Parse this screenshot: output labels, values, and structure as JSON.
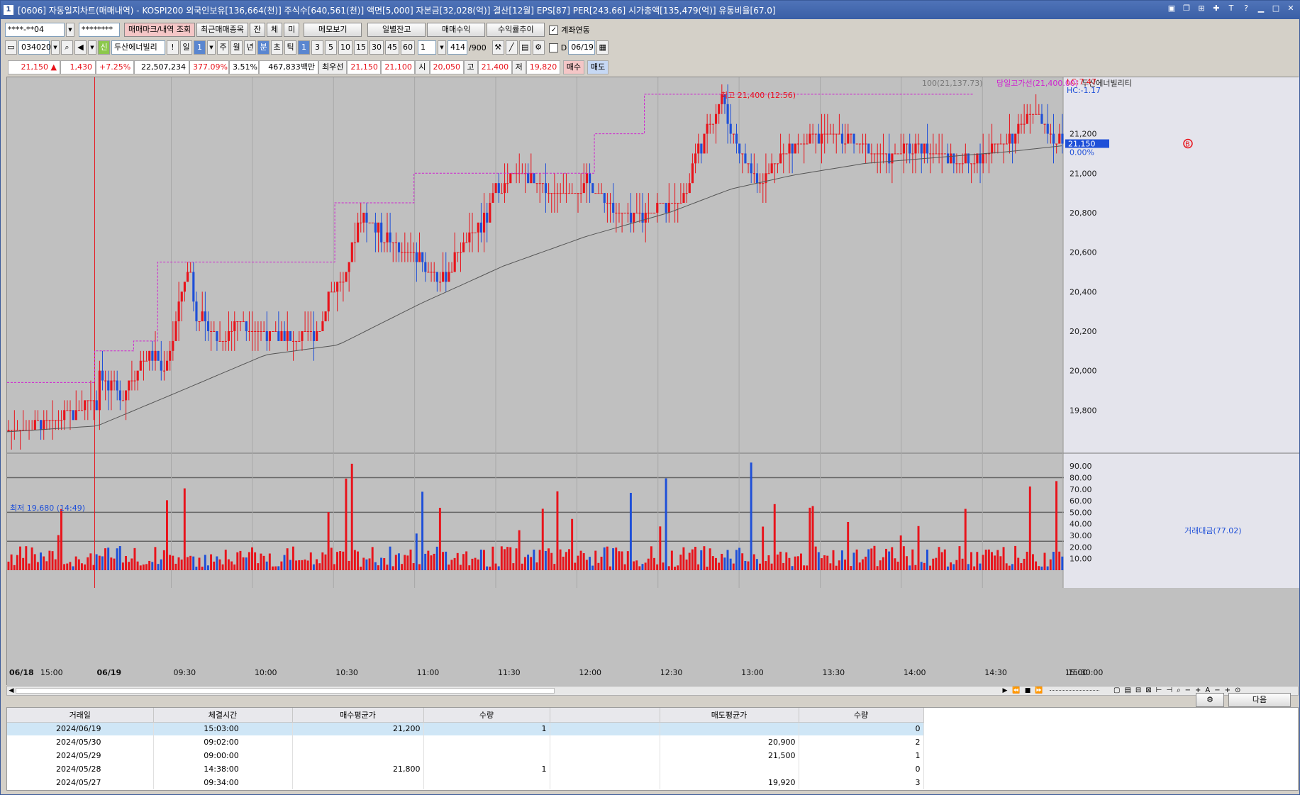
{
  "window": {
    "title": "[0606] 자동일지차트(매매내역) - KOSPI200 외국인보유[136,664(천)] 주식수[640,561(천)] 액면[5,000] 자본금[32,028(억)] 결산[12월] EPS[87] PER[243.66] 시가총액[135,479(억)] 유통비율[67.0]",
    "app_icon": "1"
  },
  "toolbar1": {
    "account": "****-**04",
    "password": "********",
    "trade_mark_btn": "매매마크/내역 조회",
    "recent_btn": "최근매매종목",
    "jan_btn": "잔",
    "che_btn": "체",
    "mi_btn": "미",
    "memo_btn": "메모보기",
    "daily_btn": "일별잔고",
    "profit_btn": "매매수익",
    "rate_btn": "수익률추이",
    "link_label": "계좌연동"
  },
  "toolbar2": {
    "code": "034020",
    "stock_name": "두산에너빌리",
    "periods": [
      "일",
      "1",
      "주",
      "월",
      "년",
      "분",
      "초",
      "틱"
    ],
    "intervals": [
      "1",
      "3",
      "5",
      "10",
      "15",
      "30",
      "45",
      "60"
    ],
    "unit": "1",
    "count": "414",
    "count_max": "/900",
    "date_label": "D",
    "date": "06/19"
  },
  "quote": {
    "price": "21,150 ▲",
    "change": "1,430",
    "rate": "+7.25%",
    "volume": "22,507,234",
    "vol_rate": "377.09%",
    "turnover": "3.51%",
    "amount": "467,833백만",
    "best_label": "최우선",
    "ask": "21,150",
    "bid": "21,100",
    "open_label": "시",
    "open": "20,050",
    "high_label": "고",
    "high": "21,400",
    "low_label": "저",
    "low": "19,820",
    "buy_btn": "매수",
    "sell_btn": "매도"
  },
  "chart_labels": {
    "ma_label": "100(21,137.73)",
    "high_line_label": "당일고가선(21,400.00)",
    "name_label": "두산에너빌리티",
    "lc": "LC:7.47",
    "hc": "HC:-1.17",
    "high_note": "최고 21,400 (12:56)",
    "low_note": "최저 19,680 (14:49)",
    "current_tag": "21,150",
    "pct_tag": "0.00%",
    "vol_label": "거래대금(77.02)",
    "b_marker": "B",
    "time_end": "15:30:00"
  },
  "chart_data": {
    "type": "bar",
    "title": "두산에너빌리티",
    "price_ylim": [
      19600,
      21450
    ],
    "price_ticks": [
      "21,200",
      "21,000",
      "20,800",
      "20,600",
      "20,400",
      "20,200",
      "20,000",
      "19,800"
    ],
    "volume_ticks": [
      "90.00",
      "80.00",
      "70.00",
      "60.00",
      "50.00",
      "40.00",
      "30.00",
      "20.00",
      "10.00"
    ],
    "x_ticks": [
      "06/18",
      "15:00",
      "06/19",
      "09:30",
      "10:00",
      "10:30",
      "11:00",
      "11:30",
      "12:00",
      "12:30",
      "13:00",
      "13:30",
      "14:00",
      "14:30",
      "15:00"
    ],
    "price_path_anchors": [
      [
        0,
        19690
      ],
      [
        30,
        19730
      ],
      [
        55,
        19760
      ],
      [
        70,
        19800
      ],
      [
        80,
        19850
      ],
      [
        86,
        19820
      ],
      [
        87,
        20020
      ],
      [
        95,
        19920
      ],
      [
        110,
        19880
      ],
      [
        125,
        20020
      ],
      [
        140,
        20080
      ],
      [
        150,
        20000
      ],
      [
        160,
        20200
      ],
      [
        170,
        20450
      ],
      [
        175,
        20550
      ],
      [
        180,
        20300
      ],
      [
        195,
        20200
      ],
      [
        210,
        20150
      ],
      [
        220,
        20250
      ],
      [
        240,
        20200
      ],
      [
        260,
        20180
      ],
      [
        280,
        20150
      ],
      [
        300,
        20200
      ],
      [
        310,
        20400
      ],
      [
        325,
        20450
      ],
      [
        340,
        20800
      ],
      [
        360,
        20700
      ],
      [
        380,
        20600
      ],
      [
        400,
        20550
      ],
      [
        420,
        20450
      ],
      [
        440,
        20650
      ],
      [
        460,
        20750
      ],
      [
        470,
        20900
      ],
      [
        490,
        21000
      ],
      [
        510,
        20950
      ],
      [
        530,
        20900
      ],
      [
        560,
        20950
      ],
      [
        580,
        20850
      ],
      [
        600,
        20750
      ],
      [
        620,
        20800
      ],
      [
        640,
        20850
      ],
      [
        655,
        20900
      ],
      [
        665,
        21100
      ],
      [
        675,
        21200
      ],
      [
        690,
        21380
      ],
      [
        700,
        21200
      ],
      [
        715,
        21050
      ],
      [
        730,
        20950
      ],
      [
        745,
        21100
      ],
      [
        770,
        21150
      ],
      [
        800,
        21200
      ],
      [
        830,
        21120
      ],
      [
        860,
        21080
      ],
      [
        880,
        21150
      ],
      [
        900,
        21100
      ],
      [
        920,
        21050
      ],
      [
        950,
        21120
      ],
      [
        975,
        21200
      ],
      [
        990,
        21350
      ],
      [
        1000,
        21250
      ],
      [
        1010,
        21180
      ],
      [
        1022,
        21150
      ]
    ],
    "ma100_anchors": [
      [
        0,
        19690
      ],
      [
        87,
        19720
      ],
      [
        160,
        19880
      ],
      [
        250,
        20080
      ],
      [
        320,
        20130
      ],
      [
        400,
        20340
      ],
      [
        480,
        20530
      ],
      [
        560,
        20680
      ],
      [
        640,
        20800
      ],
      [
        700,
        20920
      ],
      [
        760,
        20990
      ],
      [
        830,
        21050
      ],
      [
        900,
        21080
      ],
      [
        970,
        21110
      ],
      [
        1022,
        21140
      ]
    ]
  },
  "trades_table": {
    "headers": [
      "거래일",
      "체결시간",
      "매수평균가",
      "수량",
      "",
      "매도평균가",
      "수량"
    ],
    "rows": [
      [
        "2024/06/19",
        "15:03:00",
        "21,200",
        "1",
        "",
        "",
        "0"
      ],
      [
        "2024/05/30",
        "09:02:00",
        "",
        "",
        "",
        "20,900",
        "2"
      ],
      [
        "2024/05/29",
        "09:00:00",
        "",
        "",
        "",
        "21,500",
        "1"
      ],
      [
        "2024/05/28",
        "14:38:00",
        "21,800",
        "1",
        "",
        "",
        "0"
      ],
      [
        "2024/05/27",
        "09:34:00",
        "",
        "",
        "",
        "19,920",
        "3"
      ]
    ],
    "next_btn": "다음"
  },
  "colors": {
    "up": "#e8131b",
    "down": "#1e4fd8",
    "ma": "#555555",
    "high_line": "#d020d0",
    "chart_bg": "#c0c0c0"
  }
}
